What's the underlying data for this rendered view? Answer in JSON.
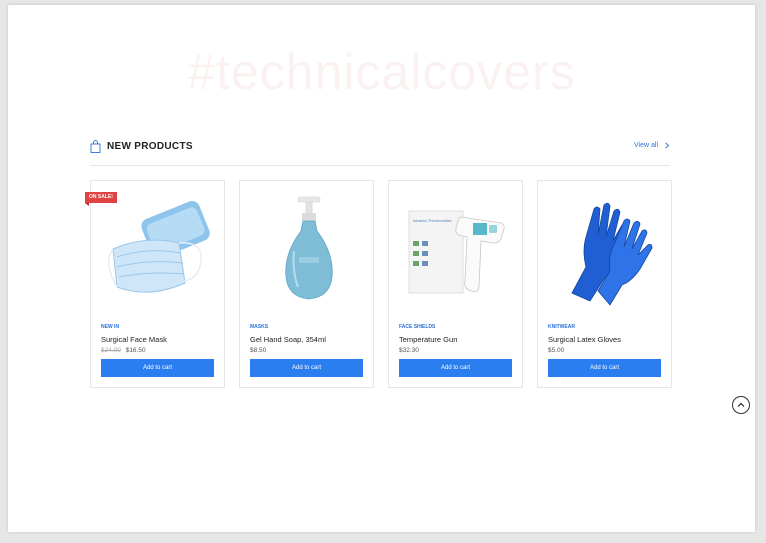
{
  "watermark": "#technicalcovers",
  "section": {
    "title": "NEW PRODUCTS",
    "view_all": "View all",
    "icon": "shopping-bag-icon"
  },
  "products": [
    {
      "badge": "ON SALE!",
      "category": "NEW IN",
      "name": "Surgical Face Mask",
      "old_price": "$24.00",
      "price": "$16.50",
      "button": "Add to cart"
    },
    {
      "category": "MASKS",
      "name": "Gel Hand Soap, 354ml",
      "price": "$8.50",
      "button": "Add to cart"
    },
    {
      "category": "FACE SHIELDS",
      "name": "Temperature Gun",
      "price": "$32.30",
      "button": "Add to cart",
      "box_text": "Infrared Thermometer"
    },
    {
      "category": "KNITWEAR",
      "name": "Surgical Latex Gloves",
      "price": "$5.00",
      "button": "Add to cart"
    }
  ],
  "colors": {
    "accent": "#2b7ef0",
    "link": "#2a6fd6",
    "sale": "#e04343"
  },
  "scroll_top_icon": "chevron-up-icon"
}
